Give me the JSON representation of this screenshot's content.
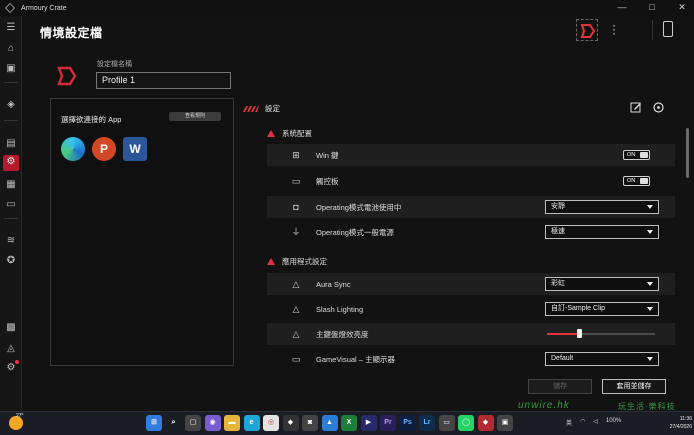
{
  "window": {
    "title": "Armoury Crate",
    "controls": [
      "—",
      "□",
      "✕"
    ]
  },
  "rail": {
    "items": [
      "menu-icon",
      "home-icon",
      "device-icon",
      "aura-icon",
      "game-library-icon",
      "scenario-profiles-icon",
      "gamevisual-icon",
      "hardware-icon",
      "layers-icon",
      "badge-icon",
      "overlay-icon",
      "notification-icon",
      "settings-icon"
    ],
    "active_index": 5,
    "settings_has_badge": true
  },
  "header": {
    "title": "情境設定檔"
  },
  "profile": {
    "name_label": "設定檔名稱",
    "name_value": "Profile 1"
  },
  "apps": {
    "title": "選擇欲連接的 App",
    "view_button": "查看規則",
    "icons": [
      {
        "name": "microsoft-edge-icon",
        "color": "#1fa5d6"
      },
      {
        "name": "powerpoint-icon",
        "color": "#d24726"
      },
      {
        "name": "word-icon",
        "color": "#2b579a"
      }
    ]
  },
  "settings": {
    "title": "設定",
    "system_section": "系統配置",
    "app_section": "應用程式設定",
    "rows": {
      "win_key": {
        "label": "Win 鍵",
        "state": "ON"
      },
      "touchpad": {
        "label": "觸控板",
        "state": "ON"
      },
      "op_battery": {
        "label": "Operating模式電池使用中",
        "value": "安靜"
      },
      "op_ac": {
        "label": "Operating模式一般電源",
        "value": "極速"
      },
      "aura_sync": {
        "label": "Aura Sync",
        "value": "彩虹"
      },
      "slash_lighting": {
        "label": "Slash Lighting",
        "value": "自訂-Sample Clip"
      },
      "brightness": {
        "label": "主鍵盤燈效亮度",
        "level": 0.3
      },
      "gamevisual": {
        "label": "GameVisual – 主顯示器",
        "value": "Default"
      }
    },
    "save_button": "儲存",
    "apply_button": "套用並儲存"
  },
  "taskbar": {
    "weather_temp": "27°",
    "tray_language": "英",
    "battery": "100%",
    "time": "11:36",
    "date": "27/4/2026"
  },
  "watermark": {
    "text": "unwire.hk",
    "cn": "玩生活·樂科技"
  },
  "accent": "#b51a2a"
}
